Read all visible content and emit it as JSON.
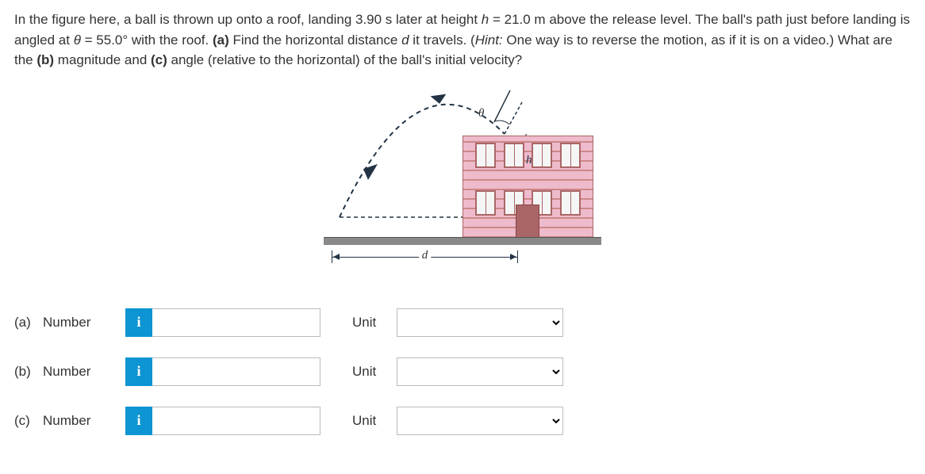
{
  "problem": {
    "part1": "In the figure here, a ball is thrown up onto a roof, landing 3.90 s later at height ",
    "h_eq": "h",
    "part2": " = 21.0 m above the release level. The ball's path just before landing is angled at ",
    "theta_eq": "θ",
    "part3": " = 55.0° with the roof. ",
    "a_label": "(a)",
    "part4": " Find the horizontal distance ",
    "d_var": "d",
    "part5": " it travels. (",
    "hint_label": "Hint:",
    "hint_text": " One way is to reverse the motion, as if it is on a video.) What are the ",
    "b_label": "(b)",
    "part6": " magnitude and ",
    "c_label": "(c)",
    "part7": " angle (relative to the horizontal) of the ball's initial velocity?"
  },
  "figure": {
    "theta": "θ",
    "h": "h",
    "d": "d"
  },
  "rows": {
    "a": {
      "letter": "(a)",
      "number_label": "Number",
      "unit_label": "Unit",
      "info": "i"
    },
    "b": {
      "letter": "(b)",
      "number_label": "Number",
      "unit_label": "Unit",
      "info": "i"
    },
    "c": {
      "letter": "(c)",
      "number_label": "Number",
      "unit_label": "Unit",
      "info": "i"
    }
  }
}
